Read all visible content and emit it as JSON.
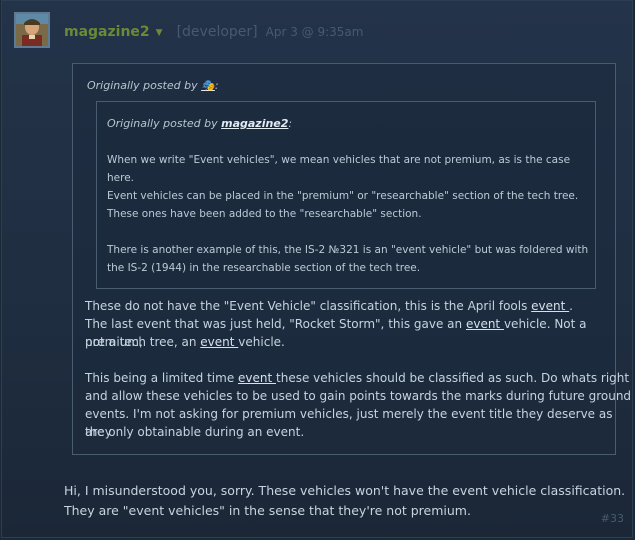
{
  "comment": {
    "author": "magazine2",
    "role": "[developer]",
    "date": "Apr 3 @ 9:35am",
    "post_number": "#33",
    "reply_lines": [
      "Hi, I misunderstood you, sorry. These vehicles won't have the event vehicle classification.",
      "They are \"event vehicles\" in the sense that they're not premium."
    ]
  },
  "outer_quote": {
    "prefix": "Originally posted by ",
    "author": "🎭",
    "suffix": ":",
    "lines": {
      "l1_pre": "These do not have the \"Event Vehicle\" classification, this is the April fools ",
      "l1_link": "event ",
      "l1_post": ".",
      "l2_pre": "The last event that was just held, \"Rocket Storm\", this gave an ",
      "l2_link": "event ",
      "l2_post": "vehicle. Not a premium,",
      "l3_pre": "not a tech tree, an ",
      "l3_link": "event ",
      "l3_post": "vehicle.",
      "l4_pre": "This being a limited time ",
      "l4_link": "event ",
      "l4_post": "these vehicles should be classified as such. Do whats right",
      "l5": "and allow these vehicles to be used to gain points towards the marks during future ground",
      "l6": "events. I'm not asking for premium vehicles, just merely the event title they deserve as they",
      "l7": "are only obtainable during an event."
    }
  },
  "inner_quote": {
    "prefix": "Originally posted by ",
    "author": "magazine2",
    "suffix": ":",
    "lines": [
      "When we write \"Event vehicles\", we mean vehicles that are not premium, as is the case here.",
      "Event vehicles can be placed in the \"premium\" or \"researchable\" section of the tech tree.",
      "These ones have been added to the \"researchable\" section.",
      "There is another example of this, the IS-2 №321 is an \"event vehicle\" but was foldered with",
      "the IS-2 (1944) in the researchable section of the tech tree."
    ]
  }
}
